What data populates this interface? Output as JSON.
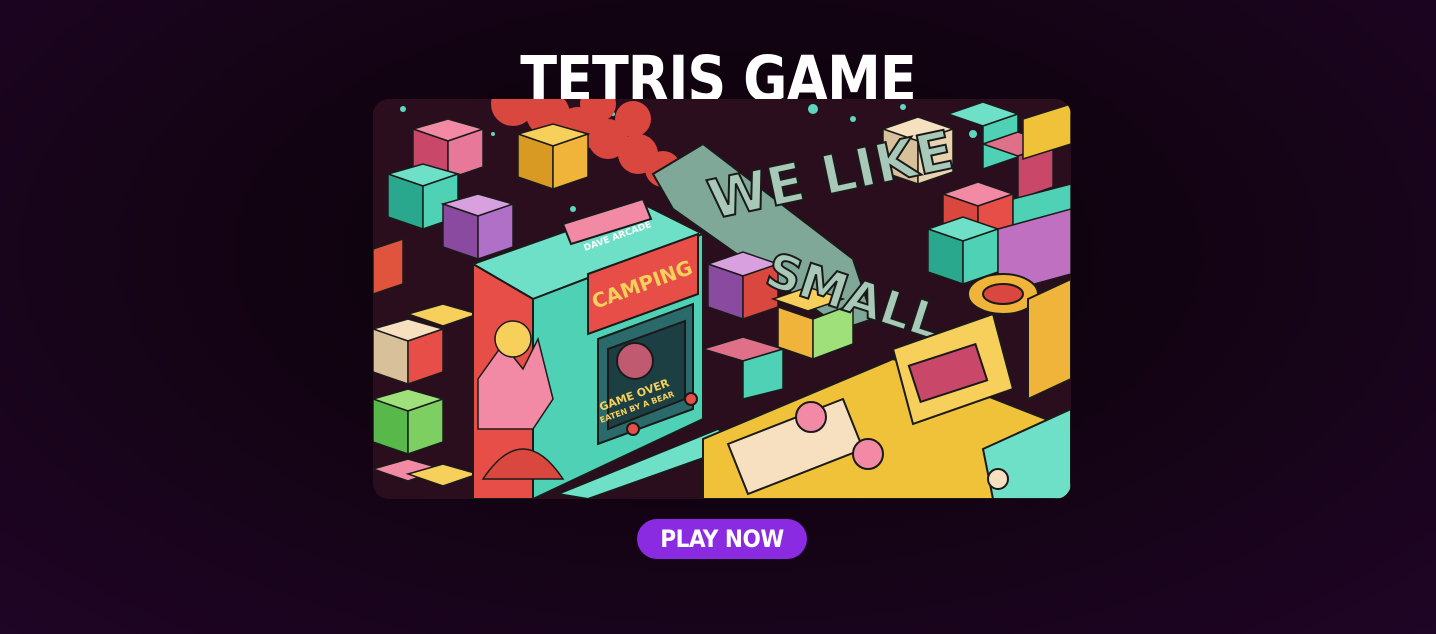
{
  "header": {
    "title": "TETRIS GAME"
  },
  "hero": {
    "art_texts": {
      "arcade_badge": "DAVE ARCADE",
      "marquee": "CAMPING",
      "screen_line1": "GAME OVER",
      "screen_line2": "EATEN BY A BEAR",
      "block_text_1": "WE LIKE",
      "block_text_2": "SMALL"
    }
  },
  "actions": {
    "play_label": "PLAY NOW"
  },
  "colors": {
    "accent": "#8a2be2",
    "teal": "#4fd1b5",
    "yellow": "#f0c23a",
    "pink": "#e0708a",
    "purple": "#a866c9",
    "red": "#d9473e"
  }
}
